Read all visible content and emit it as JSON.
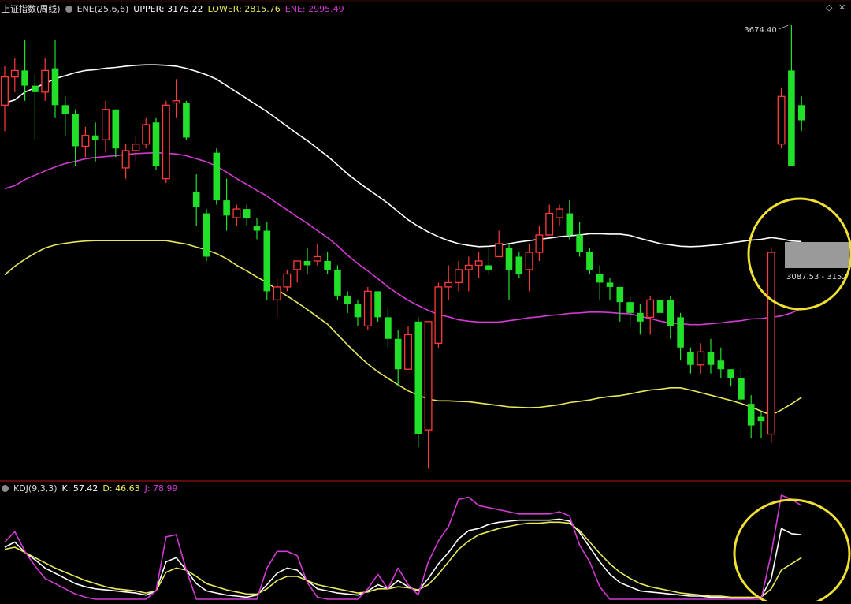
{
  "main_panel": {
    "symbol": "上证指数(周线)",
    "indicator": "ENE(25,6,6)",
    "upper": "UPPER: 3175.22",
    "lower": "LOWER: 2815.76",
    "ene": "ENE: 2995.49",
    "high_label": "3674.40",
    "range_label": "3087.53 - 3152"
  },
  "sub_panel": {
    "indicator": "KDJ(9,3,3)",
    "k": "K: 57.42",
    "d": "D: 46.63",
    "j": "J: 78.99"
  },
  "colors": {
    "up": "#ff3b3b",
    "down": "#22e02a",
    "upper_line": "#ffffff",
    "mid_line": "#d23ad2",
    "lower_line": "#e8e85a",
    "k_line": "#ffffff",
    "d_line": "#e8e85a",
    "j_line": "#d23ad2",
    "highlight_circle": "#f0e030",
    "frame": "#9a1010"
  },
  "chart_data": [
    {
      "type": "candlestick",
      "candles": [
        [
          3490,
          3555,
          3430,
          3580
        ],
        [
          3555,
          3570,
          3520,
          3600
        ],
        [
          3570,
          3535,
          3500,
          3640
        ],
        [
          3535,
          3520,
          3410,
          3560
        ],
        [
          3520,
          3570,
          3500,
          3600
        ],
        [
          3575,
          3490,
          3460,
          3640
        ],
        [
          3490,
          3470,
          3420,
          3510
        ],
        [
          3470,
          3395,
          3350,
          3480
        ],
        [
          3395,
          3420,
          3370,
          3440
        ],
        [
          3420,
          3410,
          3360,
          3450
        ],
        [
          3410,
          3480,
          3380,
          3500
        ],
        [
          3480,
          3390,
          3370,
          3480
        ],
        [
          3345,
          3385,
          3320,
          3400
        ],
        [
          3385,
          3400,
          3360,
          3420
        ],
        [
          3400,
          3445,
          3390,
          3460
        ],
        [
          3450,
          3350,
          3340,
          3460
        ],
        [
          3320,
          3490,
          3310,
          3500
        ],
        [
          3495,
          3500,
          3460,
          3550
        ],
        [
          3495,
          3415,
          3410,
          3500
        ],
        [
          3290,
          3255,
          3210,
          3330
        ],
        [
          3240,
          3140,
          3130,
          3250
        ],
        [
          3380,
          3270,
          3260,
          3390
        ],
        [
          3270,
          3235,
          3200,
          3320
        ],
        [
          3230,
          3250,
          3210,
          3260
        ],
        [
          3250,
          3230,
          3210,
          3260
        ],
        [
          3210,
          3200,
          3180,
          3230
        ],
        [
          3200,
          3060,
          3040,
          3220
        ],
        [
          3040,
          3070,
          3000,
          3090
        ],
        [
          3070,
          3100,
          3060,
          3110
        ],
        [
          3110,
          3130,
          3080,
          3130
        ],
        [
          3130,
          3120,
          3100,
          3160
        ],
        [
          3130,
          3140,
          3120,
          3170
        ],
        [
          3130,
          3110,
          3100,
          3150
        ],
        [
          3110,
          3050,
          3040,
          3120
        ],
        [
          3050,
          3030,
          3010,
          3060
        ],
        [
          3030,
          3000,
          2980,
          3040
        ],
        [
          2980,
          3060,
          2970,
          3070
        ],
        [
          3060,
          3000,
          2990,
          3060
        ],
        [
          3000,
          2950,
          2930,
          3020
        ],
        [
          2950,
          2880,
          2840,
          2970
        ],
        [
          2880,
          2960,
          2880,
          2980
        ],
        [
          2990,
          2730,
          2700,
          3000
        ],
        [
          2740,
          2990,
          2650,
          2990
        ],
        [
          2940,
          3070,
          2930,
          3080
        ],
        [
          3070,
          3080,
          3040,
          3120
        ],
        [
          3080,
          3110,
          3060,
          3130
        ],
        [
          3110,
          3120,
          3060,
          3140
        ],
        [
          3120,
          3130,
          3090,
          3150
        ],
        [
          3120,
          3110,
          3100,
          3160
        ],
        [
          3140,
          3170,
          3150,
          3200
        ],
        [
          3160,
          3110,
          3040,
          3170
        ],
        [
          3140,
          3100,
          3090,
          3150
        ],
        [
          3110,
          3150,
          3060,
          3170
        ],
        [
          3150,
          3190,
          3130,
          3210
        ],
        [
          3190,
          3240,
          3190,
          3260
        ],
        [
          3230,
          3250,
          3210,
          3260
        ],
        [
          3240,
          3190,
          3180,
          3270
        ],
        [
          3190,
          3150,
          3140,
          3220
        ],
        [
          3150,
          3110,
          3100,
          3160
        ],
        [
          3100,
          3080,
          3040,
          3120
        ],
        [
          3080,
          3070,
          3040,
          3090
        ],
        [
          3070,
          3035,
          2990,
          3060
        ],
        [
          3035,
          3010,
          2980,
          3050
        ],
        [
          3010,
          2990,
          2960,
          3030
        ],
        [
          3000,
          3040,
          2960,
          3050
        ],
        [
          3040,
          3010,
          3010,
          3040
        ],
        [
          3040,
          2980,
          2950,
          3050
        ],
        [
          3000,
          2930,
          2900,
          3010
        ],
        [
          2920,
          2890,
          2870,
          2930
        ],
        [
          2890,
          2920,
          2870,
          2940
        ],
        [
          2920,
          2890,
          2870,
          2950
        ],
        [
          2900,
          2880,
          2860,
          2930
        ],
        [
          2880,
          2860,
          2840,
          2880
        ],
        [
          2860,
          2810,
          2800,
          2880
        ],
        [
          2800,
          2750,
          2720,
          2820
        ],
        [
          2770,
          2760,
          2720,
          2780
        ],
        [
          2730,
          3150,
          2710,
          3160
        ],
        [
          3400,
          3510,
          3390,
          3530
        ],
        [
          3570,
          3350,
          3350,
          3674.4
        ],
        [
          3490,
          3455,
          3430,
          3510
        ]
      ],
      "upper": [
        3495,
        3502,
        3520,
        3530,
        3540,
        3551,
        3558,
        3565,
        3570,
        3572,
        3575,
        3577,
        3580,
        3582,
        3583,
        3583,
        3582,
        3580,
        3575,
        3568,
        3560,
        3550,
        3535,
        3520,
        3505,
        3490,
        3475,
        3458,
        3441,
        3424,
        3408,
        3390,
        3372,
        3352,
        3331,
        3313,
        3296,
        3280,
        3263,
        3244,
        3225,
        3210,
        3197,
        3186,
        3177,
        3170,
        3166,
        3163,
        3164,
        3166,
        3170,
        3174,
        3177,
        3180,
        3183,
        3186,
        3188,
        3190,
        3193,
        3193,
        3192,
        3192,
        3189,
        3182,
        3176,
        3170,
        3167,
        3164,
        3163,
        3164,
        3166,
        3168,
        3172,
        3175,
        3178,
        3180,
        3184,
        3181,
        3176,
        3175
      ],
      "mid": [
        3297,
        3304,
        3318,
        3328,
        3338,
        3347,
        3355,
        3360,
        3366,
        3369,
        3371,
        3373,
        3376,
        3378,
        3379,
        3380,
        3379,
        3377,
        3373,
        3366,
        3359,
        3349,
        3335,
        3320,
        3307,
        3293,
        3280,
        3263,
        3248,
        3232,
        3217,
        3200,
        3184,
        3165,
        3143,
        3124,
        3107,
        3089,
        3070,
        3054,
        3039,
        3027,
        3016,
        3006,
        3001,
        2994,
        2991,
        2989,
        2989,
        2989,
        2992,
        2995,
        2999,
        3001,
        3004,
        3006,
        3009,
        3010,
        3012,
        3012,
        3011,
        3009,
        3008,
        3002,
        2997,
        2991,
        2987,
        2985,
        2983,
        2983,
        2985,
        2987,
        2990,
        2992,
        2996,
        2997,
        3000,
        3003,
        3010,
        3020
      ],
      "lower": [
        3098,
        3118,
        3134,
        3148,
        3160,
        3167,
        3171,
        3174,
        3176,
        3177,
        3177,
        3177,
        3177,
        3177,
        3177,
        3177,
        3177,
        3173,
        3169,
        3162,
        3156,
        3147,
        3135,
        3120,
        3107,
        3093,
        3080,
        3064,
        3049,
        3034,
        3018,
        3001,
        2984,
        2960,
        2936,
        2913,
        2892,
        2874,
        2859,
        2844,
        2830,
        2820,
        2811,
        2807,
        2807,
        2806,
        2805,
        2802,
        2799,
        2796,
        2793,
        2792,
        2791,
        2792,
        2795,
        2798,
        2803,
        2806,
        2809,
        2814,
        2817,
        2819,
        2823,
        2828,
        2832,
        2834,
        2837,
        2837,
        2832,
        2826,
        2820,
        2814,
        2808,
        2801,
        2793,
        2783,
        2774,
        2786,
        2800,
        2815
      ],
      "ylim": [
        2640,
        3700
      ],
      "annotations": [
        "3674.40",
        "3087.53 - 3152"
      ]
    },
    {
      "type": "line",
      "x": [
        0,
        1,
        2,
        3,
        4,
        5,
        6,
        7,
        8,
        9,
        10,
        11,
        12,
        13,
        14,
        15,
        16,
        17,
        18,
        19,
        20,
        21,
        22,
        23,
        24,
        25,
        26,
        27,
        28,
        29,
        30,
        31,
        32,
        33,
        34,
        35,
        36,
        37,
        38,
        39,
        40,
        41,
        42,
        43,
        44,
        45,
        46,
        47,
        48,
        49,
        50,
        51,
        52,
        53,
        54,
        55,
        56,
        57,
        58,
        59,
        60,
        61,
        62,
        63,
        64,
        65,
        66,
        67,
        68,
        69,
        70,
        71,
        72,
        73,
        74,
        75,
        76,
        77,
        78,
        79
      ],
      "series": [
        {
          "name": "K",
          "values": [
            50,
            55,
            45,
            38,
            30,
            25,
            20,
            15,
            12,
            10,
            9,
            8,
            7,
            6,
            4,
            8,
            36,
            40,
            28,
            15,
            8,
            6,
            4,
            3,
            2,
            4,
            14,
            25,
            30,
            28,
            18,
            10,
            8,
            6,
            5,
            4,
            8,
            14,
            10,
            18,
            12,
            8,
            20,
            34,
            45,
            58,
            66,
            68,
            72,
            74,
            75,
            76,
            76,
            76,
            76,
            77,
            75,
            64,
            50,
            36,
            24,
            16,
            12,
            8,
            7,
            6,
            5,
            4,
            3,
            3,
            2,
            2,
            1,
            1,
            1,
            2,
            20,
            68,
            63,
            62
          ]
        },
        {
          "name": "D",
          "values": [
            48,
            50,
            45,
            40,
            35,
            30,
            26,
            22,
            18,
            15,
            12,
            10,
            9,
            8,
            6,
            8,
            26,
            30,
            28,
            22,
            15,
            12,
            9,
            7,
            5,
            5,
            10,
            18,
            22,
            22,
            18,
            14,
            12,
            10,
            8,
            6,
            7,
            10,
            10,
            12,
            11,
            9,
            14,
            24,
            36,
            48,
            56,
            62,
            65,
            68,
            70,
            72,
            73,
            73,
            74,
            74,
            73,
            66,
            55,
            44,
            34,
            26,
            20,
            15,
            12,
            10,
            8,
            6,
            5,
            4,
            3,
            3,
            2,
            2,
            2,
            2,
            10,
            28,
            34,
            40
          ]
        },
        {
          "name": "J",
          "values": [
            55,
            65,
            46,
            32,
            20,
            15,
            10,
            5,
            2,
            0,
            0,
            0,
            0,
            0,
            0,
            8,
            60,
            62,
            28,
            0,
            0,
            0,
            0,
            0,
            0,
            0,
            30,
            46,
            46,
            42,
            16,
            2,
            0,
            0,
            0,
            0,
            10,
            24,
            10,
            30,
            14,
            4,
            36,
            56,
            70,
            96,
            98,
            90,
            88,
            86,
            84,
            82,
            82,
            82,
            82,
            84,
            80,
            52,
            36,
            12,
            0,
            0,
            0,
            0,
            0,
            0,
            0,
            0,
            0,
            0,
            0,
            0,
            0,
            0,
            0,
            0,
            44,
            100,
            96,
            90
          ]
        }
      ],
      "ylim": [
        0,
        100
      ]
    }
  ]
}
